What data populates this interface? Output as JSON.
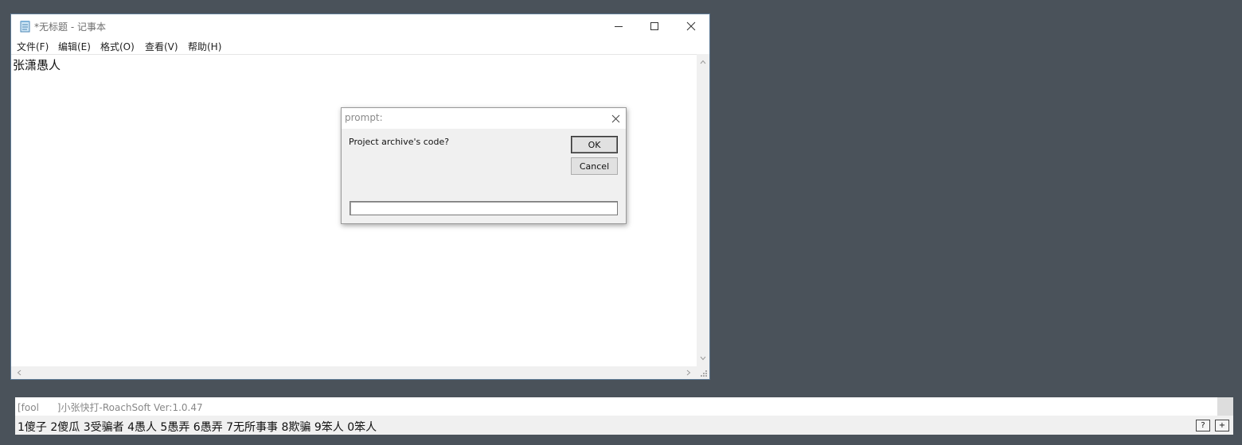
{
  "notepad": {
    "title": "*无标题 - 记事本",
    "menu": [
      "文件(F)",
      "编辑(E)",
      "格式(O)",
      "查看(V)",
      "帮助(H)"
    ],
    "content": "张潇愚人"
  },
  "dialog": {
    "title": "prompt:",
    "message": "Project archive's code?",
    "ok_label": "OK",
    "cancel_label": "Cancel",
    "input_value": ""
  },
  "toolbar": {
    "status": "[fool      ]小张快打-RoachSoft Ver:1.0.47",
    "candidates": "1傻子 2傻瓜 3受骗者 4愚人 5愚弄 6愚弄 7无所事事 8欺骗 9笨人 0笨人",
    "help_label": "?",
    "add_label": "+"
  },
  "colors": {
    "desktop": "#4a525a",
    "dialog_bg": "#f0f0f0",
    "accent_border": "#5f7b96"
  },
  "icons": [
    "notepad-icon",
    "minimize-icon",
    "maximize-icon",
    "close-icon",
    "scroll-up-icon",
    "scroll-down-icon",
    "scroll-left-icon",
    "scroll-right-icon",
    "resize-grip-icon"
  ]
}
